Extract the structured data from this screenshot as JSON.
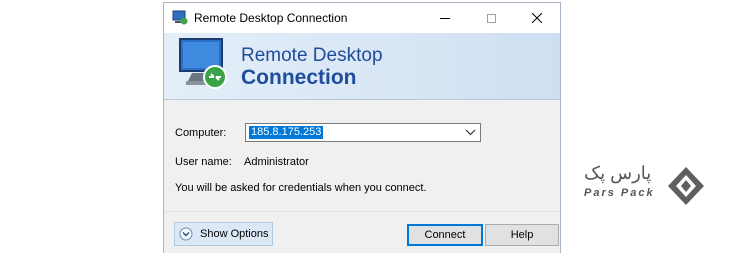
{
  "window": {
    "title": "Remote Desktop Connection"
  },
  "banner": {
    "line1": "Remote Desktop",
    "line2": "Connection"
  },
  "form": {
    "computer_label": "Computer:",
    "computer_value": "185.8.175.253",
    "username_label": "User name:",
    "username_value": "Administrator",
    "info_text": "You will be asked for credentials when you connect."
  },
  "buttons": {
    "show_options": "Show Options",
    "connect": "Connect",
    "help": "Help"
  },
  "logo": {
    "text_fa": "پارس پک",
    "text_en": "Pars Pack"
  },
  "colors": {
    "accent": "#0078d7",
    "banner_text": "#1e4d9b",
    "logo_gray": "#555555"
  },
  "icons": {
    "app": "rdc-monitor-icon",
    "minimize": "minimize-icon",
    "maximize": "maximize-icon",
    "close": "close-icon",
    "dropdown": "chevron-down-icon",
    "options": "circle-chevron-down-icon"
  }
}
